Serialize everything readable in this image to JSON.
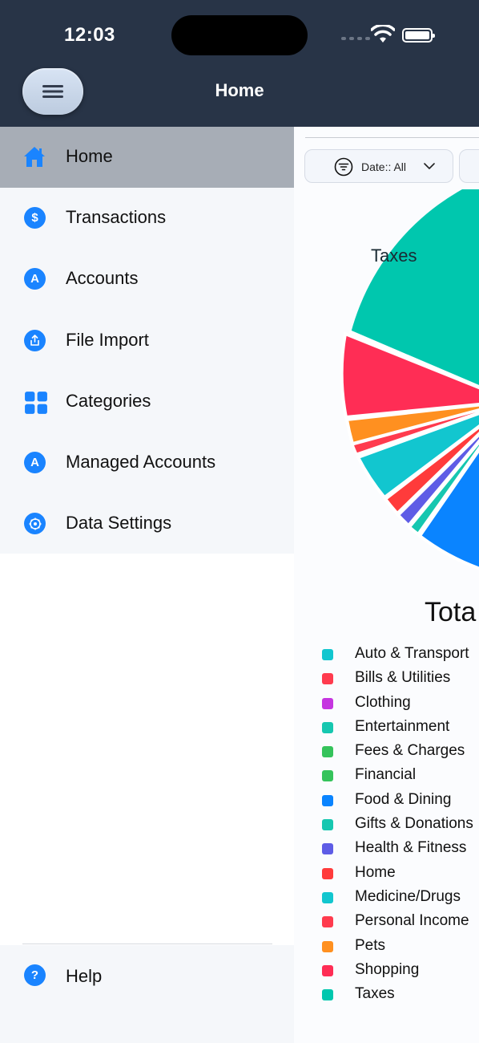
{
  "status_bar": {
    "time": "12:03"
  },
  "header": {
    "title": "Home",
    "menu_icon": "hamburger-icon"
  },
  "drawer": {
    "items": [
      {
        "label": "Home",
        "icon": "house-icon",
        "active": true
      },
      {
        "label": "Transactions",
        "icon": "dollar-icon",
        "glyph": "$"
      },
      {
        "label": "Accounts",
        "icon": "accounts-icon",
        "glyph": "A"
      },
      {
        "label": "File Import",
        "icon": "upload-icon"
      },
      {
        "label": "Categories",
        "icon": "grid-icon"
      },
      {
        "label": "Managed Accounts",
        "icon": "accounts-icon",
        "glyph": "A"
      },
      {
        "label": "Data Settings",
        "icon": "gear-icon"
      }
    ],
    "footer": {
      "label": "Help",
      "icon": "help-icon",
      "glyph": "?"
    }
  },
  "filters": {
    "date_label": "Date:: All"
  },
  "chart": {
    "slice_label": "Taxes",
    "total_title": "Tota"
  },
  "legend": [
    {
      "label": "Auto & Transport",
      "color": "#12c6cf"
    },
    {
      "label": "Bills & Utilities",
      "color": "#ff3b4e"
    },
    {
      "label": "Clothing",
      "color": "#c535e0"
    },
    {
      "label": "Entertainment",
      "color": "#16c7b0"
    },
    {
      "label": "Fees & Charges",
      "color": "#35c35b"
    },
    {
      "label": "Financial",
      "color": "#35c35b"
    },
    {
      "label": "Food & Dining",
      "color": "#0a84ff"
    },
    {
      "label": "Gifts & Donations",
      "color": "#16c7b0"
    },
    {
      "label": "Health & Fitness",
      "color": "#5e5ce6"
    },
    {
      "label": "Home",
      "color": "#ff3b3b"
    },
    {
      "label": "Medicine/Drugs",
      "color": "#12c6cf"
    },
    {
      "label": "Personal Income",
      "color": "#ff3b4e"
    },
    {
      "label": "Pets",
      "color": "#ff9020"
    },
    {
      "label": "Shopping",
      "color": "#ff2d55"
    },
    {
      "label": "Taxes",
      "color": "#00c7ae"
    }
  ],
  "colors": {
    "header_bg": "#283447",
    "accent": "#1a84ff",
    "active_item_bg": "#a7adb6"
  }
}
